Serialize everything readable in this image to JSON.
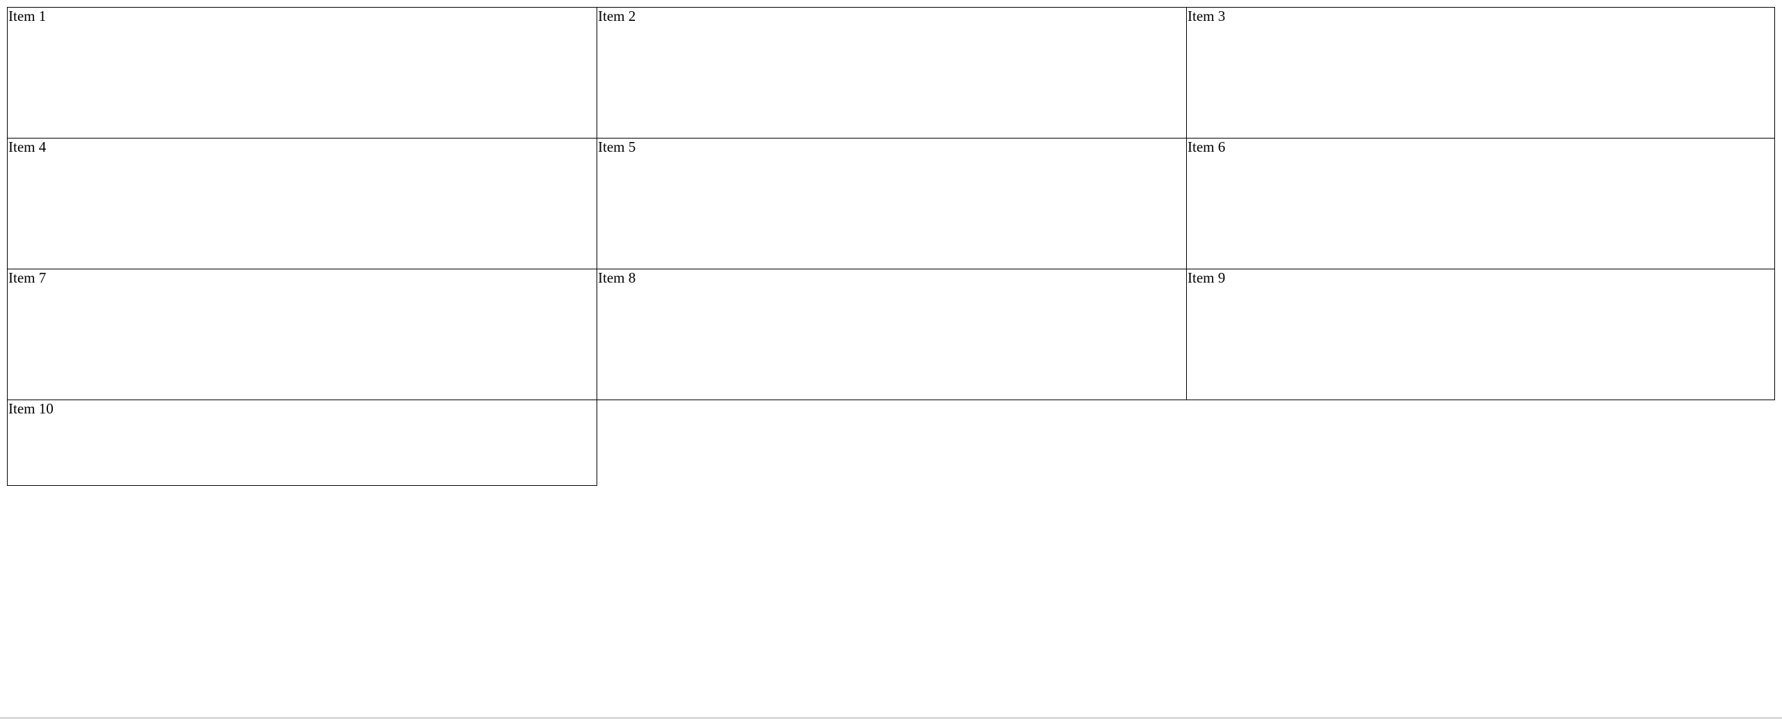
{
  "grid": {
    "items": [
      {
        "label": "Item 1"
      },
      {
        "label": "Item 2"
      },
      {
        "label": "Item 3"
      },
      {
        "label": "Item 4"
      },
      {
        "label": "Item 5"
      },
      {
        "label": "Item 6"
      },
      {
        "label": "Item 7"
      },
      {
        "label": "Item 8"
      },
      {
        "label": "Item 9"
      },
      {
        "label": "Item 10"
      }
    ]
  },
  "colors": {
    "background": "#ffffff",
    "border": "#000000",
    "text": "#000000"
  }
}
